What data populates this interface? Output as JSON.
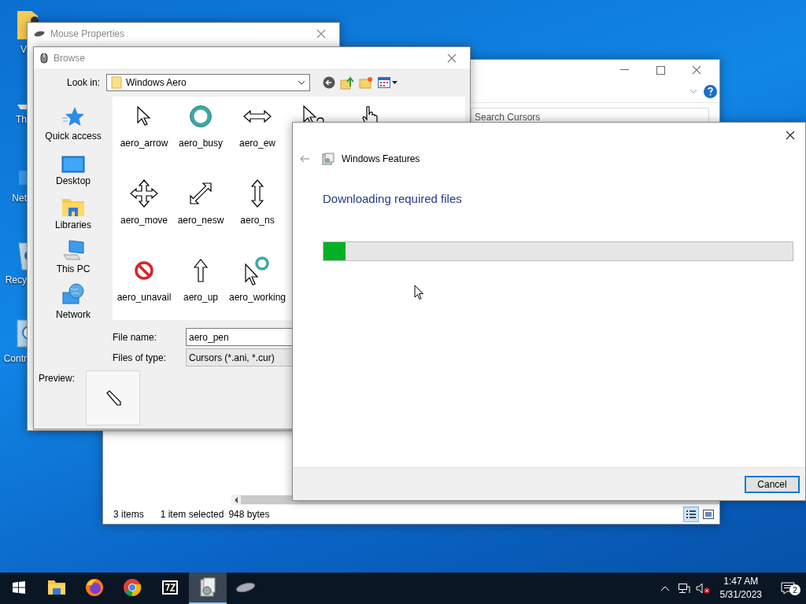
{
  "desktop_icons": [
    {
      "kind": "folder",
      "label": "V"
    },
    {
      "kind": "pc",
      "label": "Th"
    },
    {
      "kind": "network",
      "label": "Net"
    },
    {
      "kind": "bin",
      "label": "Recy"
    },
    {
      "kind": "control",
      "label": "Contr"
    }
  ],
  "explorer_window": {
    "search": {
      "placeholder": "Search Cursors"
    },
    "status_bar": {
      "item_count": "3 items",
      "selection": "1 item selected",
      "size": "948 bytes"
    },
    "view_buttons": [
      {
        "kind": "details",
        "selected": true
      },
      {
        "kind": "preview",
        "selected": false
      }
    ]
  },
  "mouse_properties": {
    "title": "Mouse Properties"
  },
  "browse_dialog": {
    "title": "Browse",
    "look_in_label": "Look in:",
    "look_in_value": "Windows Aero",
    "places": [
      {
        "kind": "star",
        "label": "Quick access"
      },
      {
        "kind": "desktop",
        "label": "Desktop"
      },
      {
        "kind": "libraries",
        "label": "Libraries"
      },
      {
        "kind": "pc",
        "label": "This PC"
      },
      {
        "kind": "network",
        "label": "Network"
      }
    ],
    "file_rows": [
      [
        {
          "kind": "arrow",
          "name": "aero_arrow"
        },
        {
          "kind": "busy",
          "name": "aero_busy"
        },
        {
          "kind": "ew",
          "name": "aero_ew"
        },
        {
          "kind": "helpsel"
        },
        {
          "kind": "link"
        }
      ],
      [
        {
          "kind": "move",
          "name": "aero_move"
        },
        {
          "kind": "nesw",
          "name": "aero_nesw"
        },
        {
          "kind": "ns",
          "name": "aero_ns"
        }
      ],
      [
        {
          "kind": "unavail",
          "name": "aero_unavail"
        },
        {
          "kind": "up",
          "name": "aero_up"
        },
        {
          "kind": "working",
          "name": "aero_working"
        }
      ]
    ],
    "file_name_label": "File name:",
    "file_name": "aero_pen",
    "file_type_label": "Files of type:",
    "file_type": "Cursors (*.ani, *.cur)",
    "preview_label": "Preview:"
  },
  "features_dialog": {
    "title": "Windows Features",
    "heading": "Downloading required files",
    "progress": {
      "level": 0.047
    },
    "cancel": "Cancel"
  },
  "taskbar": {
    "apps": [
      {
        "kind": "explorer",
        "selected": false
      },
      {
        "kind": "firefox",
        "selected": false
      },
      {
        "kind": "chrome",
        "selected": false
      },
      {
        "kind": "sevenzip",
        "selected": false
      },
      {
        "kind": "features",
        "selected": true
      },
      {
        "kind": "mouse",
        "selected": false
      }
    ],
    "time": "1:47 AM",
    "date": "5/31/2023",
    "notifications": "2"
  }
}
